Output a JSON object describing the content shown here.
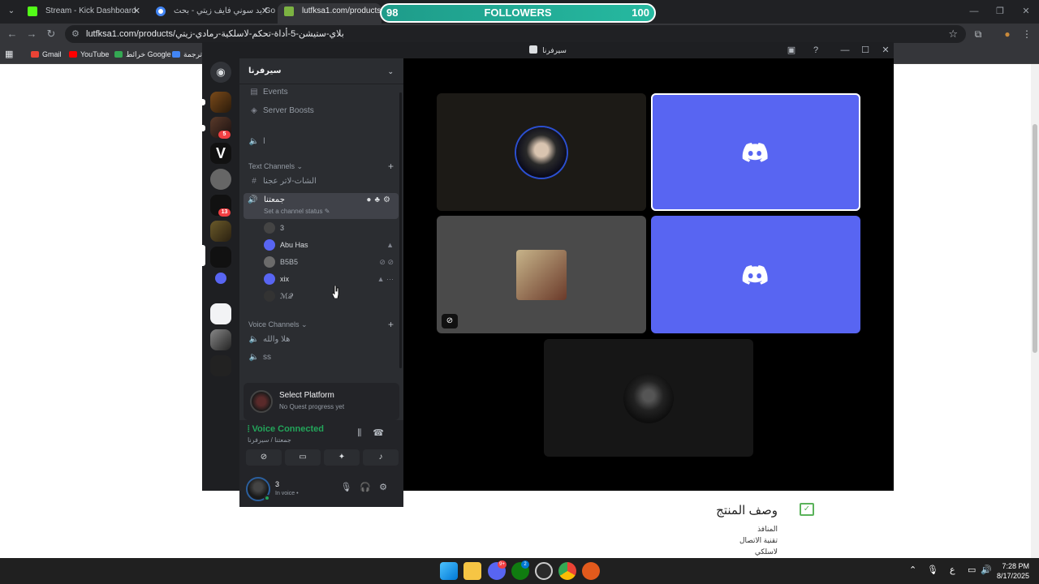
{
  "browser": {
    "tabs": [
      {
        "title": "Stream - Kick Dashboard",
        "favicon_color": "#53fc18"
      },
      {
        "title": "يد سوني فايف زيتي - بحث Google",
        "favicon_color": "#4285f4"
      },
      {
        "title": "lutfksa1.com/products/زيتي",
        "favicon_color": "#7cb342"
      }
    ],
    "url": "lutfksa1.com/products/بلاي-ستيشن-5-أداة-تحكم-لاسلكية-رمادي-زيتي",
    "bookmarks": [
      {
        "label": "Gmail",
        "color": "#ea4335"
      },
      {
        "label": "YouTube",
        "color": "#ff0000"
      },
      {
        "label": "خرائط Google",
        "color": "#34a853"
      },
      {
        "label": "ترجمة",
        "color": "#4285f4"
      }
    ]
  },
  "followers_overlay": {
    "current": "98",
    "label": "FOLLOWERS",
    "goal": "100"
  },
  "page": {
    "section_title": "وصف المنتج",
    "lines": [
      "المنافذ",
      "تقنية الاتصال",
      "لاسلكي"
    ]
  },
  "discord": {
    "window_title": "سيرفرنا",
    "server_name": "سيرفرنا",
    "guild_badges": [
      "5",
      "13"
    ],
    "top_items": [
      "Events",
      "Server Boosts"
    ],
    "stage_channel": "ا",
    "text_category": "Text Channels",
    "text_channels": [
      "الشات-لاتر عجنا"
    ],
    "active_voice": {
      "name": "جمعتنا",
      "status": "Set a channel status"
    },
    "voice_users": [
      {
        "name": "3",
        "color": "#444"
      },
      {
        "name": "Abu Has",
        "color": "#5865f2"
      },
      {
        "name": "B5B5",
        "color": "#6b6b6b"
      },
      {
        "name": "xix",
        "color": "#5865f2"
      },
      {
        "name": "ℳ𝒬",
        "color": "#333"
      }
    ],
    "voice_category": "Voice Channels",
    "voice_channels": [
      "هلا والله",
      "ss"
    ],
    "quest": {
      "title": "Select Platform",
      "subtitle": "No Quest progress yet"
    },
    "voice_connected": {
      "title": "Voice Connected",
      "subtitle": "جمعتنا / سيرفرنا"
    },
    "user": {
      "name": "3",
      "status": "In voice •"
    }
  },
  "taskbar": {
    "badges": [
      "9+",
      "2"
    ],
    "lang": "ع",
    "time": "7:28 PM",
    "date": "8/17/2025"
  }
}
